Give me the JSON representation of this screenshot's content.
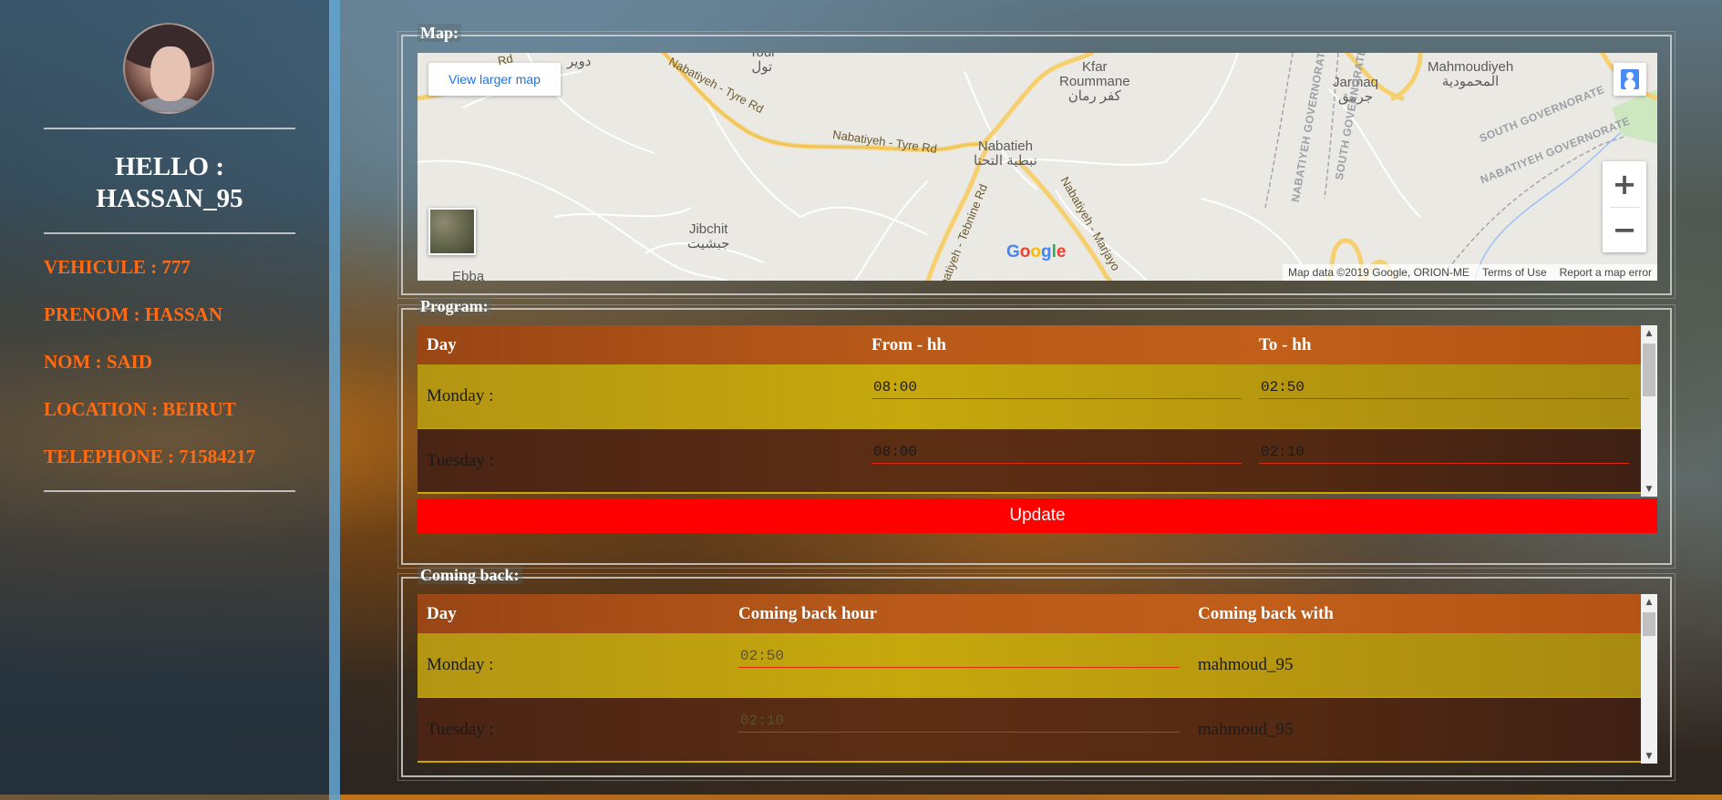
{
  "sidebar": {
    "greeting_line1": "HELLO :",
    "greeting_line2": "HASSAN_95",
    "vehicule": "VEHICULE : 777",
    "prenom": "PRENOM : HASSAN",
    "nom": "NOM : SAID",
    "location": "LOCATION : BEIRUT",
    "telephone": "TELEPHONE : 71584217"
  },
  "map": {
    "legend": "Map:",
    "view_larger": "View larger map",
    "attribution": "Map data ©2019 Google, ORION-ME",
    "terms": "Terms of Use",
    "report": "Report a map error",
    "places": {
      "kfar_roummane": "Kfar\nRoummane\nكفر رمان",
      "nabatieh": "Nabatieh\nنبطية التحتا",
      "jibchit": "Jibchit\nجبشيت",
      "jarmaq": "Jarmaq\nجرمق",
      "mahmoudiyeh": "Mahmoudiyeh\nالمحمودية",
      "ebba": "Ebba",
      "douair": "دوير",
      "toul": "Toul\nتول"
    },
    "roads": {
      "tyre1": "Nabatiyeh - Tyre Rd",
      "tyre2": "Nabatiyeh - Tyre Rd",
      "tebnine": "Nabatiyeh - Tebnine Rd",
      "marjayoun": "Nabatiyeh - Marjayo",
      "rd": "Rd"
    },
    "governorates": {
      "g1": "NABATIYEH GOVERNORATE",
      "g2": "SOUTH GOVERNORATE",
      "g3": "SOUTH GOVERNORATE",
      "g4": "NABATIYEH GOVERNORATE"
    },
    "google": {
      "G": "G",
      "o1": "o",
      "o2": "o",
      "g": "g",
      "l": "l",
      "e": "e"
    },
    "colors": {
      "blue": "#4285f4",
      "red": "#ea4335",
      "yellow": "#fbbc05",
      "green": "#34a853"
    }
  },
  "program": {
    "legend": "Program:",
    "headers": {
      "day": "Day",
      "from": "From - hh",
      "to": "To - hh"
    },
    "rows": [
      {
        "day": "Monday :",
        "from": "08:00",
        "to": "02:50"
      },
      {
        "day": "Tuesday :",
        "from": "08:00",
        "to": "02:10"
      }
    ],
    "update_label": "Update"
  },
  "coming_back": {
    "legend": "Coming back:",
    "headers": {
      "day": "Day",
      "hour": "Coming back hour",
      "with": "Coming back with"
    },
    "rows": [
      {
        "day": "Monday :",
        "hour": "02:50",
        "with": "mahmoud_95"
      },
      {
        "day": "Tuesday :",
        "hour": "02:10",
        "with": "mahmoud_95"
      }
    ]
  },
  "icons": {
    "zoom_in": "+",
    "zoom_out": "−",
    "scroll_up": "▲",
    "scroll_down": "▼"
  }
}
